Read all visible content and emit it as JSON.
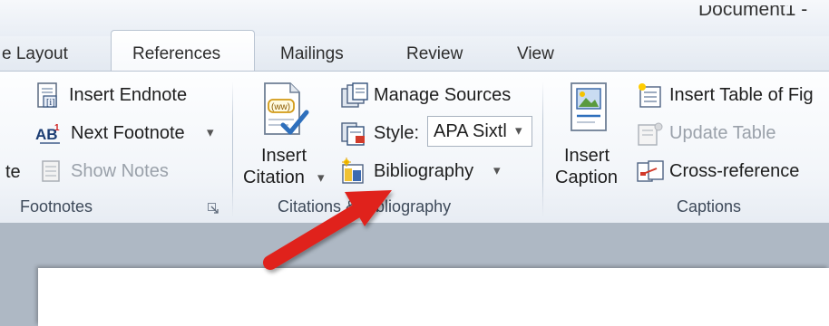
{
  "window": {
    "title": "Document1 -"
  },
  "tabs": [
    {
      "label": "e Layout"
    },
    {
      "label": "References"
    },
    {
      "label": "Mailings"
    },
    {
      "label": "Review"
    },
    {
      "label": "View"
    }
  ],
  "footnotes": {
    "insert_endnote": "Insert Endnote",
    "next_footnote": "Next Footnote",
    "partial_label": "te",
    "show_notes": "Show Notes",
    "group_label": "Footnotes",
    "dropdown_arrow": "▾"
  },
  "citations": {
    "insert_citation_line1": "Insert",
    "insert_citation_line2": "Citation",
    "manage_sources": "Manage Sources",
    "style_label": "Style:",
    "style_value": "APA Sixtl",
    "bibliography": "Bibliography",
    "group_label": "Citations & Bibliography",
    "dropdown_arrow": "▾"
  },
  "captions": {
    "insert_caption_line1": "Insert",
    "insert_caption_line2": "Caption",
    "insert_table_of_figures": "Insert Table of Fig",
    "update_table": "Update Table",
    "cross_reference": "Cross-reference",
    "group_label": "Captions"
  },
  "colors": {
    "annotation_arrow": "#e0201a"
  }
}
